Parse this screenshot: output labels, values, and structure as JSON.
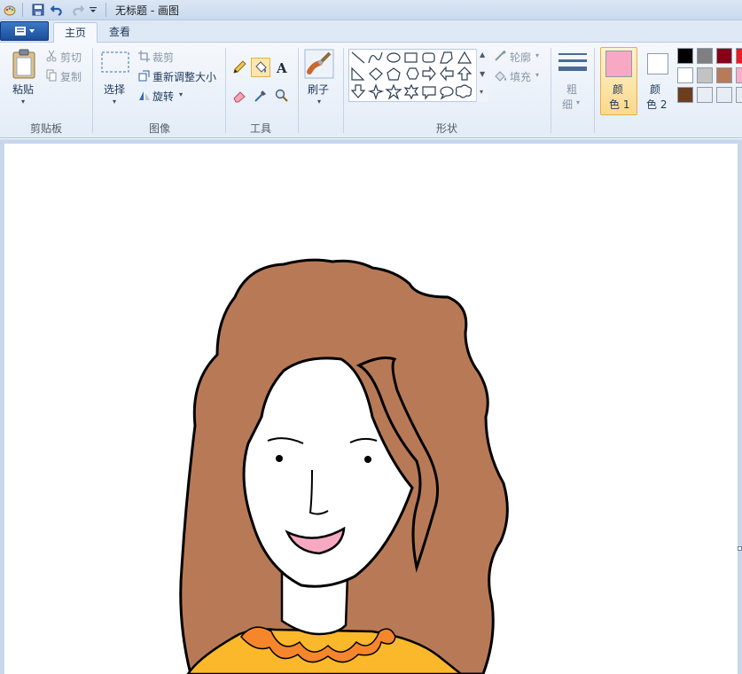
{
  "window": {
    "title": "无标题 - 画图"
  },
  "tabs": [
    {
      "label": "主页"
    },
    {
      "label": "查看"
    }
  ],
  "ribbon": {
    "clipboard": {
      "paste": "粘贴",
      "cut": "剪切",
      "copy": "复制",
      "group_label": "剪贴板"
    },
    "image": {
      "select": "选择",
      "crop": "裁剪",
      "resize": "重新调整大小",
      "rotate": "旋转",
      "group_label": "图像"
    },
    "tools": {
      "group_label": "工具"
    },
    "brushes": {
      "label": "刷子"
    },
    "shapes": {
      "outline": "轮廓",
      "fill": "填充",
      "group_label": "形状"
    },
    "size": {
      "label_line1": "粗",
      "label_line2": "细"
    },
    "colors": {
      "color1_line1": "颜",
      "color1_line2": "色 1",
      "color2_line1": "颜",
      "color2_line2": "色 2",
      "color1_value": "#f9a8c3",
      "color2_value": "#ffffff",
      "palette": [
        "#000000",
        "#7f7f7f",
        "#880015",
        "#ed1c24",
        "#ffffff",
        "#c3c3c3",
        "#b97a57",
        "#ffaec9",
        "#6b3e1f",
        "#e8edf4",
        "#e8edf4",
        "#e8edf4"
      ]
    }
  },
  "drawing": {
    "hair_color": "#b87a56",
    "shirt_color": "#fbb82a",
    "collar_color": "#f6862b",
    "mouth_color": "#f7a9c2",
    "skin_color": "#ffffff"
  }
}
